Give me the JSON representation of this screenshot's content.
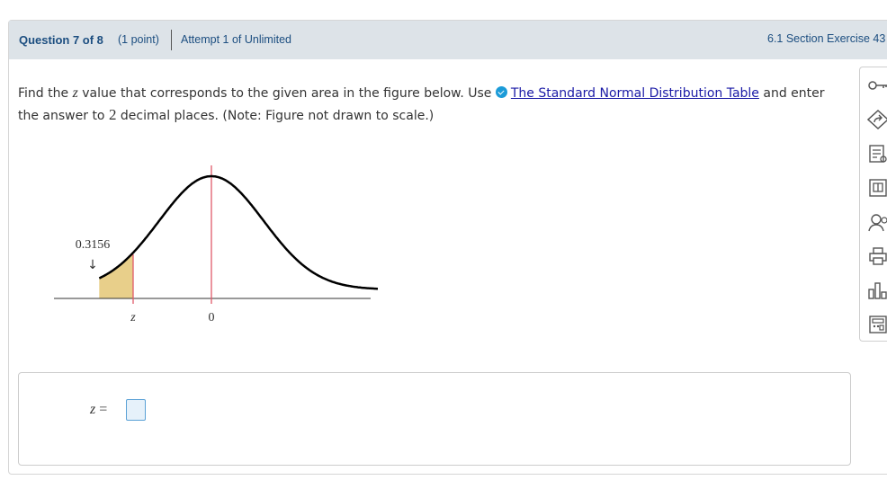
{
  "header": {
    "question": "Question 7 of 8",
    "points": "(1 point)",
    "attempt": "Attempt 1 of Unlimited",
    "section": "6.1 Section Exercise 43"
  },
  "prompt": {
    "line_a": "Find the ",
    "var_z": "z",
    "line_b": " value that corresponds to the given area in the figure below. Use ",
    "link_text": "The Standard Normal Distribution Table",
    "line_c": " and enter the answer to ",
    "decimals": "2",
    "line_d": " decimal places. (Note: Figure not drawn to scale.)"
  },
  "figure": {
    "area_label": "0.3156",
    "arrow": "↓",
    "z_label": "z",
    "zero_label": "0",
    "shaded_area": 0.3156,
    "shade_color": "#e8cf8a",
    "line_color": "#e05a6a"
  },
  "answer": {
    "label_var": "z",
    "label_eq": " =",
    "input_value": ""
  },
  "toolbar": [
    {
      "icon": "key-icon"
    },
    {
      "icon": "hint-icon"
    },
    {
      "icon": "notes-icon"
    },
    {
      "icon": "textbook-icon"
    },
    {
      "icon": "help-icon"
    },
    {
      "icon": "print-icon"
    },
    {
      "icon": "chart-icon"
    },
    {
      "icon": "calculator-icon"
    }
  ],
  "colors": {
    "header_bg": "#dde3e8",
    "header_text": "#1c4e80",
    "link": "#1a1aa6",
    "info": "#1b9bd8"
  }
}
